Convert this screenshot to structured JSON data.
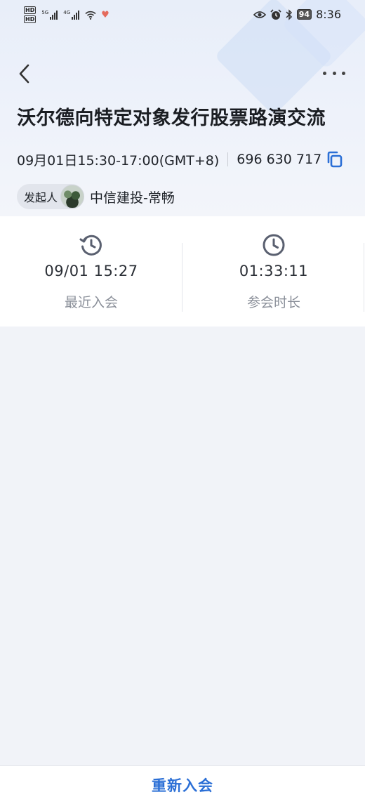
{
  "status_bar": {
    "hd_top": "HD",
    "hd_bottom": "HD",
    "network_1": "5G",
    "network_2": "4G",
    "battery": "94",
    "time": "8:36"
  },
  "meeting": {
    "title": "沃尔德向特定对象发行股票路演交流",
    "datetime": "09月01日15:30-17:00(GMT+8)",
    "meeting_id": "696 630 717",
    "host_label": "发起人",
    "host_name": "中信建投-常畅"
  },
  "stats": {
    "last_join_value": "09/01 15:27",
    "last_join_label": "最近入会",
    "duration_value": "01:33:11",
    "duration_label": "参会时长"
  },
  "actions": {
    "rejoin_label": "重新入会"
  },
  "colors": {
    "accent": "#2b6fd6",
    "page_bg": "#f1f3f8"
  }
}
